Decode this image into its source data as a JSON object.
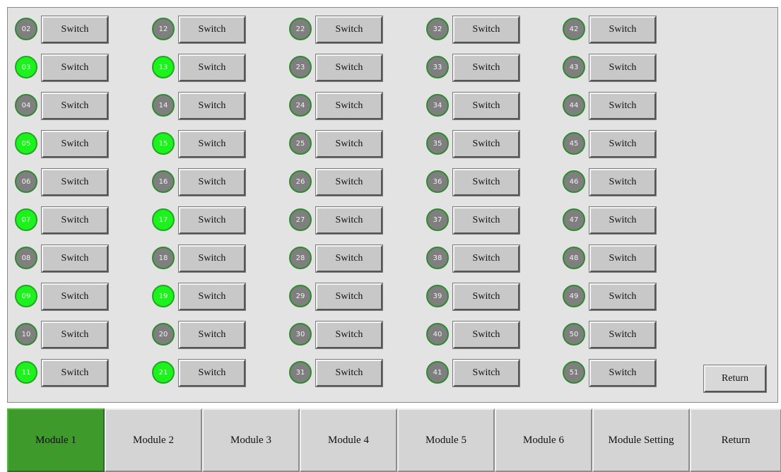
{
  "switch_label": "Switch",
  "columns": [
    {
      "channels": [
        {
          "id": "02",
          "on": false
        },
        {
          "id": "03",
          "on": true
        },
        {
          "id": "04",
          "on": false
        },
        {
          "id": "05",
          "on": true
        },
        {
          "id": "06",
          "on": false
        },
        {
          "id": "07",
          "on": true
        },
        {
          "id": "08",
          "on": false
        },
        {
          "id": "09",
          "on": true
        },
        {
          "id": "10",
          "on": false
        },
        {
          "id": "11",
          "on": true
        }
      ]
    },
    {
      "channels": [
        {
          "id": "12",
          "on": false
        },
        {
          "id": "13",
          "on": true
        },
        {
          "id": "14",
          "on": false
        },
        {
          "id": "15",
          "on": true
        },
        {
          "id": "16",
          "on": false
        },
        {
          "id": "17",
          "on": true
        },
        {
          "id": "18",
          "on": false
        },
        {
          "id": "19",
          "on": true
        },
        {
          "id": "20",
          "on": false
        },
        {
          "id": "21",
          "on": true
        }
      ]
    },
    {
      "channels": [
        {
          "id": "22",
          "on": false
        },
        {
          "id": "23",
          "on": false
        },
        {
          "id": "24",
          "on": false
        },
        {
          "id": "25",
          "on": false
        },
        {
          "id": "26",
          "on": false
        },
        {
          "id": "27",
          "on": false
        },
        {
          "id": "28",
          "on": false
        },
        {
          "id": "29",
          "on": false
        },
        {
          "id": "30",
          "on": false
        },
        {
          "id": "31",
          "on": false
        }
      ]
    },
    {
      "channels": [
        {
          "id": "32",
          "on": false
        },
        {
          "id": "33",
          "on": false
        },
        {
          "id": "34",
          "on": false
        },
        {
          "id": "35",
          "on": false
        },
        {
          "id": "36",
          "on": false
        },
        {
          "id": "37",
          "on": false
        },
        {
          "id": "38",
          "on": false
        },
        {
          "id": "39",
          "on": false
        },
        {
          "id": "40",
          "on": false
        },
        {
          "id": "41",
          "on": false
        }
      ]
    },
    {
      "channels": [
        {
          "id": "42",
          "on": false
        },
        {
          "id": "43",
          "on": false
        },
        {
          "id": "44",
          "on": false
        },
        {
          "id": "45",
          "on": false
        },
        {
          "id": "46",
          "on": false
        },
        {
          "id": "47",
          "on": false
        },
        {
          "id": "48",
          "on": false
        },
        {
          "id": "49",
          "on": false
        },
        {
          "id": "50",
          "on": false
        },
        {
          "id": "51",
          "on": false
        }
      ]
    }
  ],
  "panel_return_label": "Return",
  "tabs": [
    {
      "label": "Module 1",
      "active": true
    },
    {
      "label": "Module 2",
      "active": false
    },
    {
      "label": "Module 3",
      "active": false
    },
    {
      "label": "Module 4",
      "active": false
    },
    {
      "label": "Module 5",
      "active": false
    },
    {
      "label": "Module 6",
      "active": false
    },
    {
      "label": "Module Setting",
      "active": false
    },
    {
      "label": "Return",
      "active": false
    }
  ],
  "colors": {
    "indicator_on": "#1ef21e",
    "indicator_off": "#7f7f7f",
    "active_tab": "#3f9a2c",
    "panel_background": "#e3e3e3"
  }
}
